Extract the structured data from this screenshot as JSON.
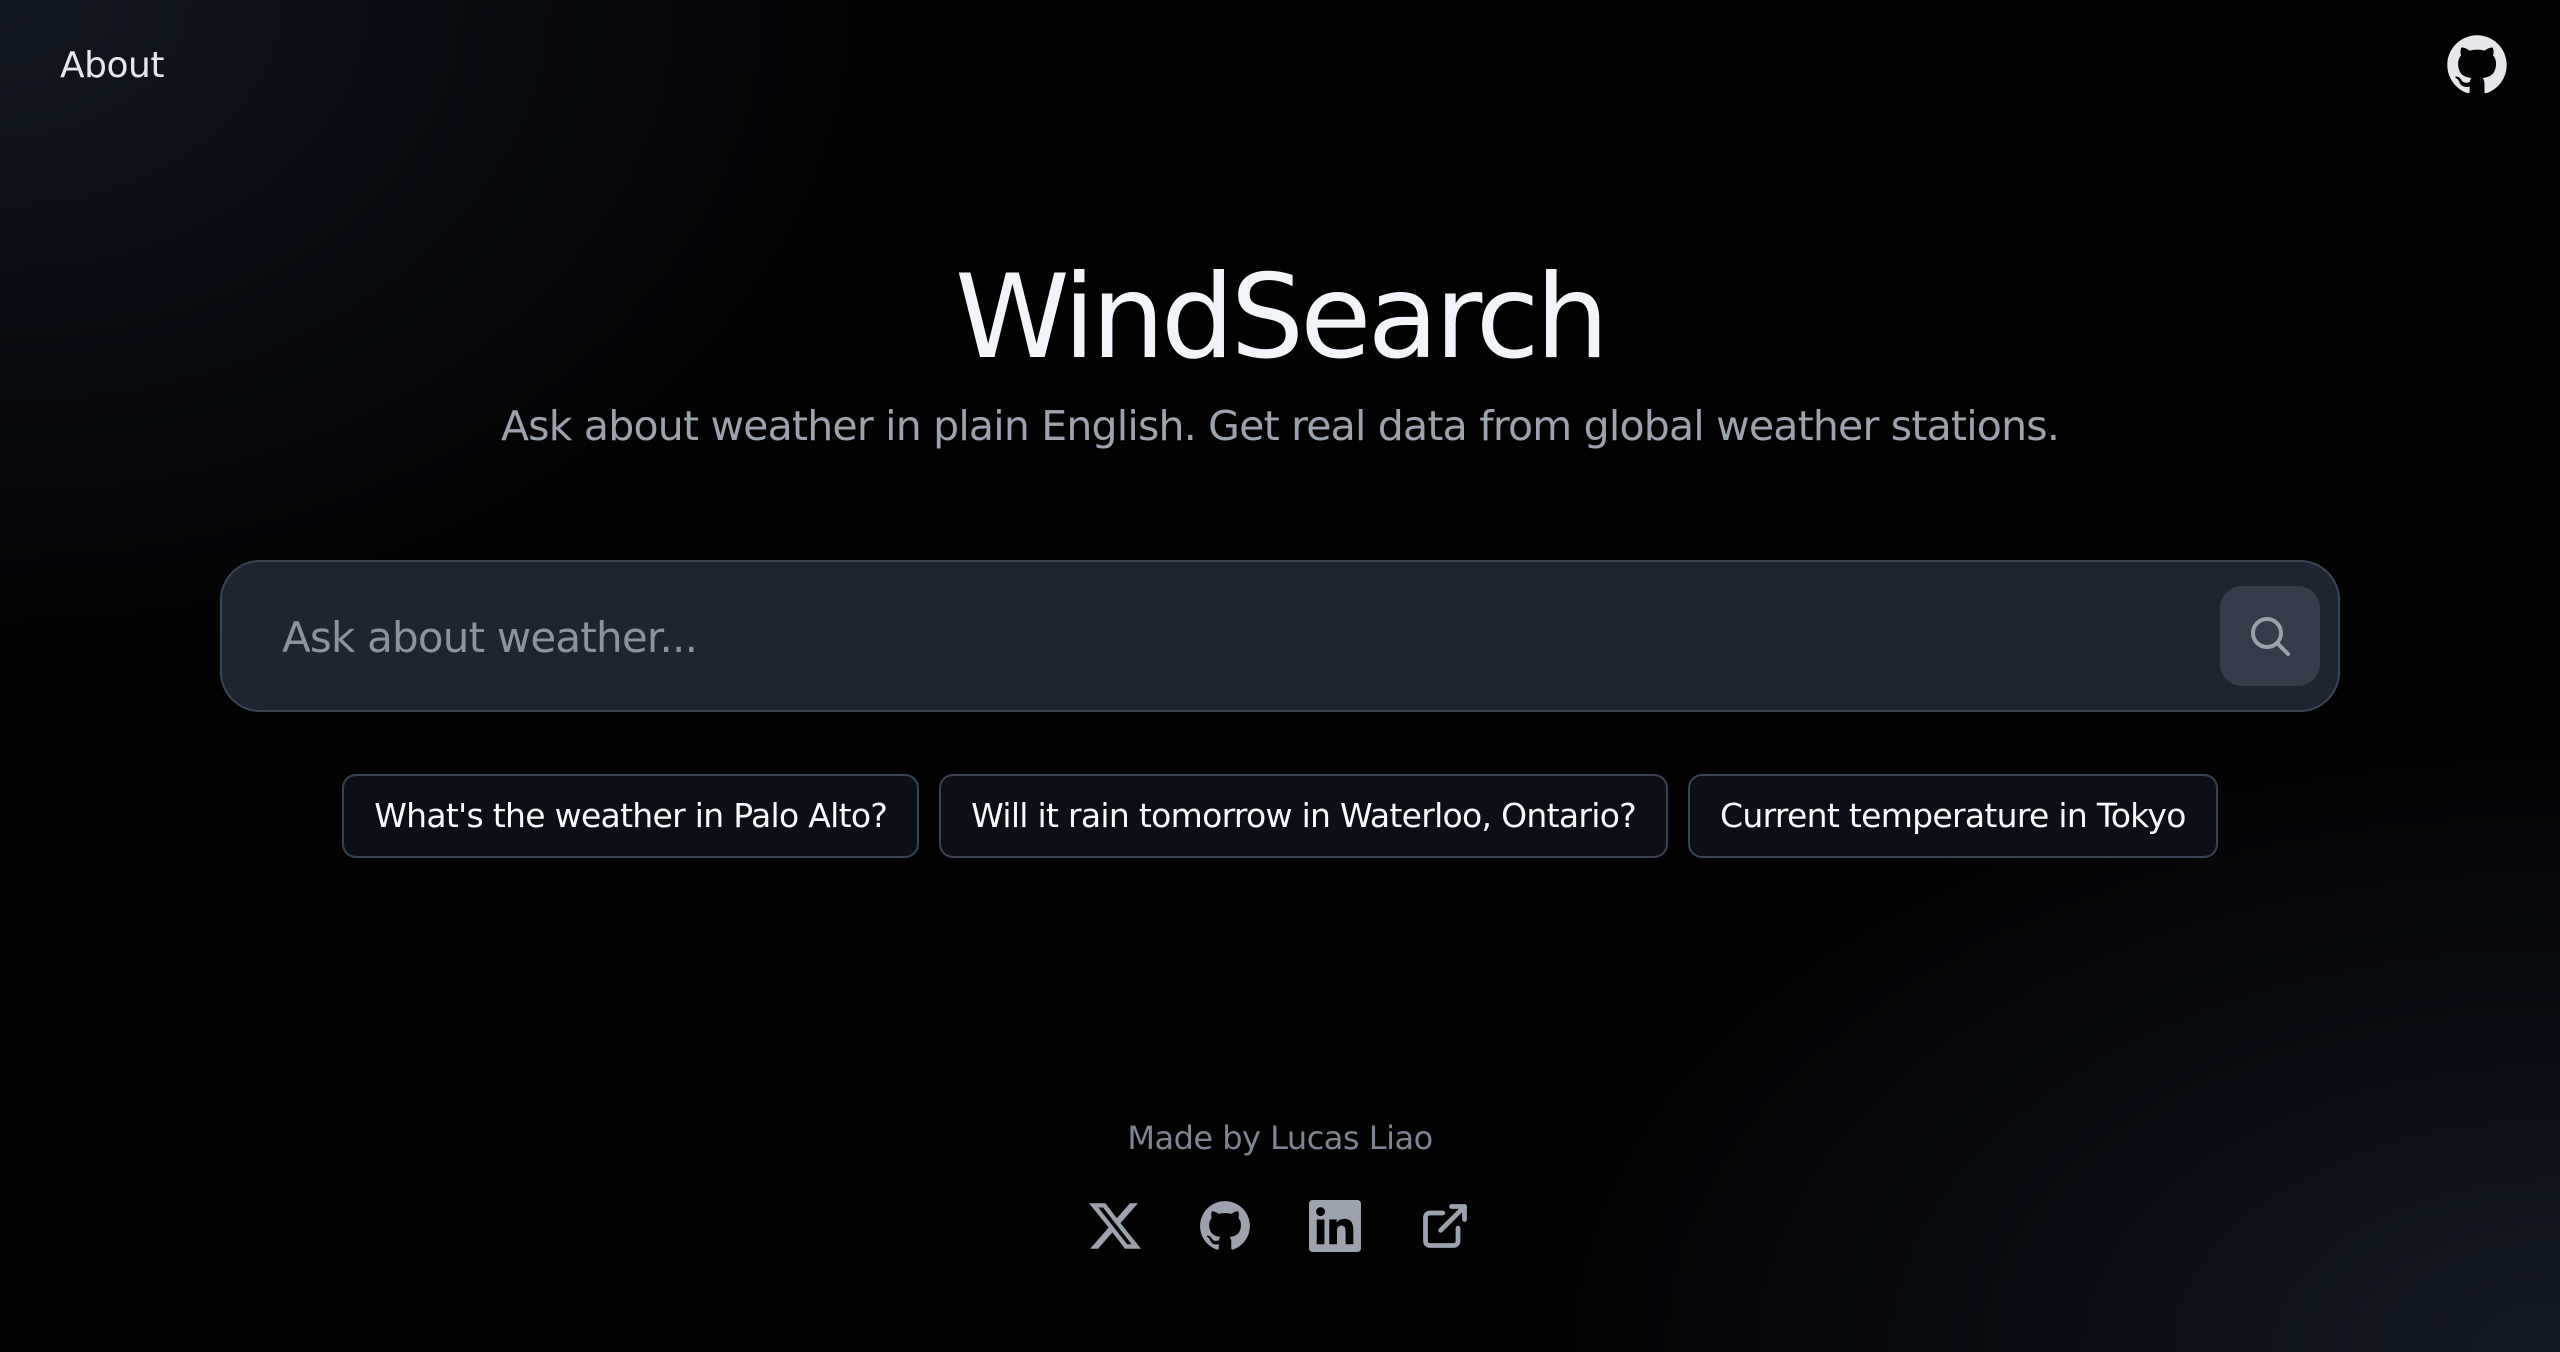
{
  "nav": {
    "about_label": "About",
    "github_icon": "github-icon"
  },
  "hero": {
    "title": "WindSearch",
    "subtitle": "Ask about weather in plain English. Get real data from global weather stations."
  },
  "search": {
    "placeholder": "Ask about weather...",
    "value": "",
    "button_icon": "search-icon"
  },
  "suggestions": [
    "What's the weather in Palo Alto?",
    "Will it rain tomorrow in Waterloo, Ontario?",
    "Current temperature in Tokyo"
  ],
  "footer": {
    "made_by": "Made by Lucas Liao",
    "social_icons": [
      "x-icon",
      "github-icon",
      "linkedin-icon",
      "external-link-icon"
    ]
  },
  "colors": {
    "background": "#020203",
    "search_background": "#1e2531",
    "search_button_background": "#343c4a",
    "chip_border": "#3b4251",
    "muted_text": "#9ca3af"
  }
}
